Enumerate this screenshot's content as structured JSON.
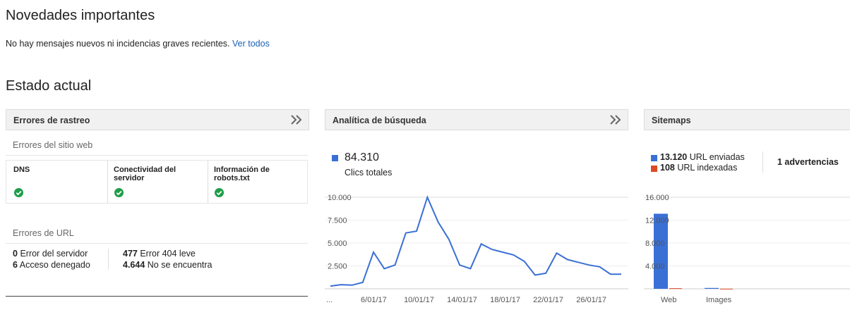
{
  "news": {
    "title": "Novedades importantes",
    "message": "No hay mensajes nuevos ni incidencias graves recientes.",
    "link": "Ver todos"
  },
  "status": {
    "title": "Estado actual"
  },
  "crawl": {
    "title": "Errores de rastreo",
    "site_errors_title": "Errores del sitio web",
    "cells": [
      {
        "label": "DNS",
        "status": "ok"
      },
      {
        "label": "Conectividad del servidor",
        "status": "ok"
      },
      {
        "label": "Información de robots.txt",
        "status": "ok"
      }
    ],
    "url_errors_title": "Errores de URL",
    "url_errors": [
      {
        "count": "0",
        "label": "Error del servidor"
      },
      {
        "count": "6",
        "label": "Acceso denegado"
      },
      {
        "count": "477",
        "label": "Error 404 leve"
      },
      {
        "count": "4.644",
        "label": "No se encuentra"
      }
    ]
  },
  "analytics": {
    "title": "Analítica de búsqueda",
    "total": "84.310",
    "total_label": "Clics totales",
    "series_color": "#3a6fd6"
  },
  "sitemaps": {
    "title": "Sitemaps",
    "sent_count": "13.120",
    "sent_label": "URL enviadas",
    "indexed_count": "108",
    "indexed_label": "URL indexadas",
    "warnings": "1 advertencias",
    "sent_color": "#3a6fd6",
    "indexed_color": "#dc4a25"
  },
  "chart_data": [
    {
      "type": "line",
      "x": [
        "1/01/17",
        "2/01/17",
        "3/01/17",
        "4/01/17",
        "5/01/17",
        "6/01/17",
        "7/01/17",
        "8/01/17",
        "9/01/17",
        "10/01/17",
        "11/01/17",
        "12/01/17",
        "13/01/17",
        "14/01/17",
        "15/01/17",
        "16/01/17",
        "17/01/17",
        "18/01/17",
        "19/01/17",
        "20/01/17",
        "21/01/17",
        "22/01/17",
        "23/01/17",
        "24/01/17",
        "25/01/17",
        "26/01/17",
        "27/01/17",
        "28/01/17",
        "29/01/17",
        "30/01/17"
      ],
      "y": [
        300,
        450,
        400,
        700,
        4000,
        2200,
        2600,
        6100,
        6300,
        10000,
        7300,
        5400,
        2600,
        2200,
        4900,
        4300,
        4000,
        3700,
        3000,
        1500,
        1700,
        3900,
        3200,
        2900,
        2600,
        2400,
        1600,
        1600
      ],
      "xtick_labels": [
        "...",
        "6/01/17",
        "10/01/17",
        "14/01/17",
        "18/01/17",
        "22/01/17",
        "26/01/17"
      ],
      "ytick_labels": [
        "10.000",
        "7.500",
        "5.000",
        "2.500"
      ],
      "ylim": [
        0,
        10000
      ],
      "grid": true
    },
    {
      "type": "bar",
      "categories": [
        "Web",
        "Images"
      ],
      "series": [
        {
          "name": "URL enviadas",
          "values": [
            13120,
            150
          ]
        },
        {
          "name": "URL indexadas",
          "values": [
            108,
            20
          ]
        }
      ],
      "ytick_labels": [
        "16.000",
        "12.000",
        "8.000",
        "4.000"
      ],
      "ylim": [
        0,
        16000
      ],
      "grid": true
    }
  ]
}
